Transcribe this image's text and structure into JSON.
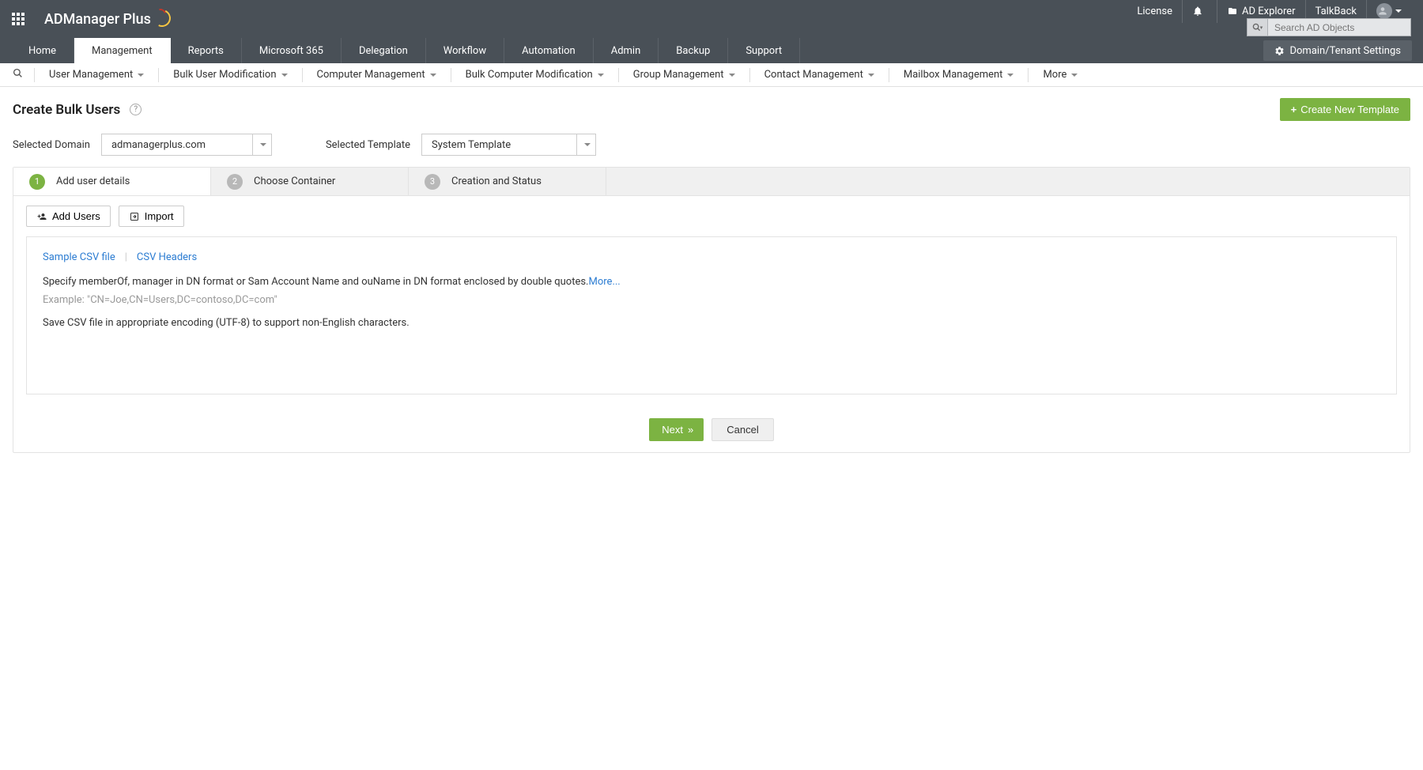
{
  "header": {
    "product_name": "ADManager Plus",
    "links": {
      "license": "License",
      "ad_explorer": "AD Explorer",
      "talkback": "TalkBack"
    },
    "search_placeholder": "Search AD Objects"
  },
  "main_tabs": [
    "Home",
    "Management",
    "Reports",
    "Microsoft 365",
    "Delegation",
    "Workflow",
    "Automation",
    "Admin",
    "Backup",
    "Support"
  ],
  "main_tab_active": "Management",
  "domain_settings_label": "Domain/Tenant Settings",
  "sub_tabs": [
    "User Management",
    "Bulk User Modification",
    "Computer Management",
    "Bulk Computer Modification",
    "Group Management",
    "Contact Management",
    "Mailbox Management",
    "More"
  ],
  "page": {
    "title": "Create Bulk Users",
    "create_template_btn": "Create New Template"
  },
  "selectors": {
    "domain_label": "Selected Domain",
    "domain_value": "admanagerplus.com",
    "template_label": "Selected Template",
    "template_value": "System Template"
  },
  "steps": [
    {
      "num": "1",
      "label": "Add user details"
    },
    {
      "num": "2",
      "label": "Choose Container"
    },
    {
      "num": "3",
      "label": "Creation and Status"
    }
  ],
  "step_active": 0,
  "actions": {
    "add_users": "Add Users",
    "import": "Import"
  },
  "info": {
    "link_sample": "Sample CSV file",
    "link_headers": "CSV Headers",
    "text_main": "Specify memberOf, manager in DN format or Sam Account Name and ouName in DN format enclosed by double quotes.",
    "more": "More...",
    "example": "Example: \"CN=Joe,CN=Users,DC=contoso,DC=com\"",
    "text_encoding": "Save CSV file in appropriate encoding (UTF-8) to support non-English characters."
  },
  "footer": {
    "next": "Next",
    "cancel": "Cancel"
  }
}
